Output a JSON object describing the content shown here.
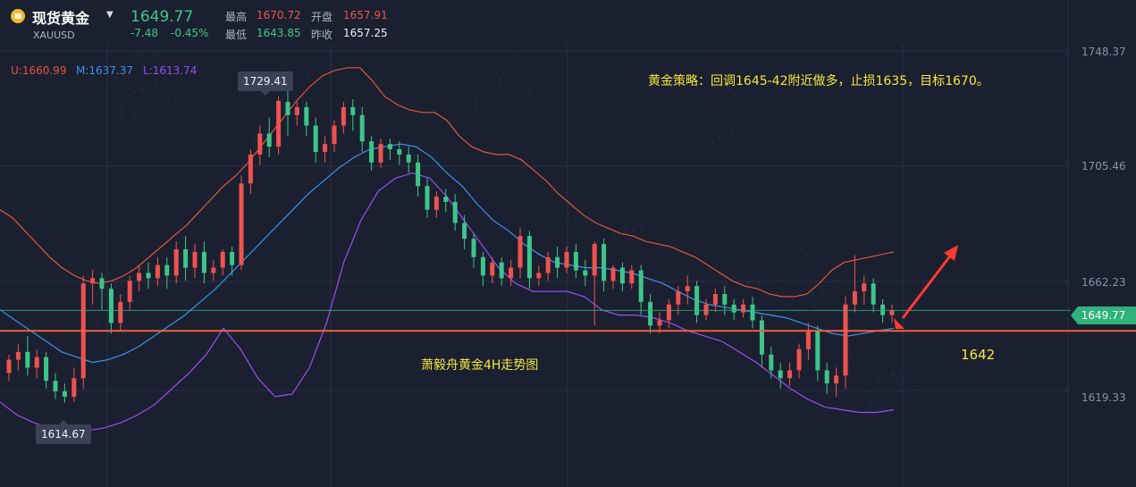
{
  "header": {
    "name": "现货黄金",
    "code": "XAUUSD",
    "price": "1649.77",
    "change": "-7.48",
    "change_pct": "-0.45%",
    "high_label": "最高",
    "high": "1670.72",
    "low_label": "最低",
    "low": "1643.85",
    "open_label": "开盘",
    "open": "1657.91",
    "prev_label": "昨收",
    "prev_close": "1657.25"
  },
  "indicator": {
    "upper": "U:1660.99",
    "middle": "M:1637.37",
    "lower": "L:1613.74"
  },
  "annotations": {
    "strategy": "黄金策略：回调1645-42附近做多，止损1635，目标1670。",
    "watermark": "萧毅舟黄金4H走势图",
    "level": "1642",
    "max_tip": "1729.41",
    "min_tip": "1614.67",
    "current_tag": "1649.77"
  },
  "colors": {
    "background": "#1b2030",
    "up": "#ef5350",
    "down": "#3ec58a",
    "boll_upper": "#e2563a",
    "boll_middle": "#3f8fe8",
    "boll_lower": "#9a4df2",
    "support_line": "#f0613c",
    "current_line": "#2fb37a",
    "annotation_text": "#f5e63c",
    "arrow": "#ff3b30"
  },
  "chart_data": {
    "type": "candlestick",
    "y_ticks": [
      1748.37,
      1705.46,
      1662.23,
      1619.33
    ],
    "ylim": [
      1595,
      1755
    ],
    "grid": true,
    "horizontal_lines": [
      {
        "name": "current",
        "value": 1649.77
      },
      {
        "name": "support",
        "value": 1642
      }
    ],
    "candles": [
      [
        1626,
        1631,
        1623,
        1633
      ],
      [
        1631,
        1634,
        1627,
        1637
      ],
      [
        1634,
        1628,
        1625,
        1640
      ],
      [
        1628,
        1632,
        1624,
        1635
      ],
      [
        1632,
        1623,
        1620,
        1634
      ],
      [
        1623,
        1619,
        1616,
        1626
      ],
      [
        1619,
        1617,
        1614.67,
        1622
      ],
      [
        1617,
        1624,
        1615,
        1628
      ],
      [
        1624,
        1660,
        1620,
        1663
      ],
      [
        1660,
        1662,
        1652,
        1665
      ],
      [
        1662,
        1658,
        1650,
        1664
      ],
      [
        1658,
        1645,
        1641,
        1660
      ],
      [
        1645,
        1653,
        1642,
        1656
      ],
      [
        1653,
        1661,
        1650,
        1663
      ],
      [
        1661,
        1664,
        1657,
        1667
      ],
      [
        1664,
        1662,
        1658,
        1668
      ],
      [
        1662,
        1667,
        1659,
        1670
      ],
      [
        1667,
        1663,
        1658,
        1670
      ],
      [
        1663,
        1673,
        1660,
        1676
      ],
      [
        1673,
        1666,
        1661,
        1678
      ],
      [
        1666,
        1672,
        1662,
        1675
      ],
      [
        1672,
        1664,
        1660,
        1676
      ],
      [
        1664,
        1666,
        1661,
        1669
      ],
      [
        1666,
        1672,
        1663,
        1673
      ],
      [
        1672,
        1667,
        1663,
        1674
      ],
      [
        1667,
        1698,
        1665,
        1701
      ],
      [
        1698,
        1709,
        1694,
        1711
      ],
      [
        1709,
        1717,
        1705,
        1720
      ],
      [
        1717,
        1712,
        1708,
        1723
      ],
      [
        1712,
        1729.41,
        1709,
        1731
      ],
      [
        1729,
        1724,
        1716,
        1733
      ],
      [
        1724,
        1727,
        1720,
        1729
      ],
      [
        1727,
        1720,
        1716,
        1729
      ],
      [
        1720,
        1710,
        1706,
        1723
      ],
      [
        1710,
        1713,
        1706,
        1716
      ],
      [
        1713,
        1720,
        1710,
        1722
      ],
      [
        1720,
        1727,
        1717,
        1729
      ],
      [
        1727,
        1724,
        1718,
        1730
      ],
      [
        1724,
        1714,
        1710,
        1727
      ],
      [
        1714,
        1706,
        1703,
        1716
      ],
      [
        1706,
        1713,
        1704,
        1715
      ],
      [
        1713,
        1711,
        1707,
        1715
      ],
      [
        1711,
        1709,
        1705,
        1714
      ],
      [
        1709,
        1706,
        1702,
        1712
      ],
      [
        1706,
        1697,
        1693,
        1709
      ],
      [
        1697,
        1688,
        1685,
        1700
      ],
      [
        1688,
        1693,
        1685,
        1695
      ],
      [
        1693,
        1691,
        1687,
        1696
      ],
      [
        1691,
        1683,
        1680,
        1694
      ],
      [
        1683,
        1677,
        1673,
        1686
      ],
      [
        1677,
        1670,
        1666,
        1679
      ],
      [
        1670,
        1663,
        1659,
        1672
      ],
      [
        1663,
        1668,
        1660,
        1670
      ],
      [
        1668,
        1662,
        1659,
        1670
      ],
      [
        1662,
        1666,
        1659,
        1669
      ],
      [
        1666,
        1678,
        1662,
        1681
      ],
      [
        1678,
        1662,
        1658,
        1680
      ],
      [
        1662,
        1664,
        1659,
        1667
      ],
      [
        1664,
        1670,
        1661,
        1672
      ],
      [
        1670,
        1666,
        1662,
        1674
      ],
      [
        1666,
        1672,
        1664,
        1674
      ],
      [
        1672,
        1665,
        1662,
        1675
      ],
      [
        1665,
        1663,
        1659,
        1669
      ],
      [
        1663,
        1675,
        1644,
        1676
      ],
      [
        1675,
        1661,
        1657,
        1677
      ],
      [
        1661,
        1666,
        1658,
        1667
      ],
      [
        1666,
        1660,
        1657,
        1668
      ],
      [
        1660,
        1665,
        1658,
        1667
      ],
      [
        1665,
        1653,
        1648,
        1667
      ],
      [
        1653,
        1644,
        1641,
        1656
      ],
      [
        1644,
        1646,
        1641,
        1649
      ],
      [
        1646,
        1652,
        1643,
        1654
      ],
      [
        1652,
        1657,
        1648,
        1659
      ],
      [
        1657,
        1659,
        1652,
        1663
      ],
      [
        1659,
        1648,
        1645,
        1661
      ],
      [
        1648,
        1652,
        1646,
        1654
      ],
      [
        1652,
        1656,
        1649,
        1658
      ],
      [
        1656,
        1652,
        1648,
        1659
      ],
      [
        1652,
        1649,
        1646,
        1654
      ],
      [
        1649,
        1652,
        1647,
        1654
      ],
      [
        1652,
        1646,
        1643,
        1655
      ],
      [
        1646,
        1633,
        1628,
        1648
      ],
      [
        1633,
        1627,
        1624,
        1636
      ],
      [
        1627,
        1624,
        1620,
        1630
      ],
      [
        1624,
        1627,
        1621,
        1630
      ],
      [
        1627,
        1635,
        1624,
        1637
      ],
      [
        1635,
        1642,
        1631,
        1645
      ],
      [
        1642,
        1627,
        1623,
        1644
      ],
      [
        1627,
        1622,
        1618,
        1630
      ],
      [
        1622,
        1625,
        1617,
        1628
      ],
      [
        1625,
        1652,
        1620,
        1655
      ],
      [
        1652,
        1657,
        1649,
        1670.72
      ],
      [
        1657,
        1660,
        1652,
        1663
      ],
      [
        1660,
        1652,
        1649,
        1662
      ],
      [
        1652,
        1648,
        1645,
        1654
      ],
      [
        1648,
        1649.77,
        1645,
        1652
      ]
    ],
    "bollinger": {
      "upper": [
        1688,
        1685,
        1680,
        1675,
        1670,
        1666,
        1663,
        1661,
        1660,
        1661,
        1663,
        1666,
        1670,
        1674,
        1678,
        1682,
        1687,
        1692,
        1697,
        1701,
        1706,
        1712,
        1718,
        1724,
        1730,
        1735,
        1739,
        1741,
        1742,
        1742,
        1737,
        1731,
        1728,
        1726,
        1725,
        1725,
        1722,
        1716,
        1712,
        1710,
        1709,
        1709,
        1707,
        1703,
        1699,
        1694,
        1690,
        1686,
        1683,
        1681,
        1679,
        1678,
        1676,
        1675,
        1674,
        1672,
        1670,
        1667,
        1664,
        1661,
        1659,
        1658,
        1656,
        1655,
        1655,
        1656,
        1660,
        1665,
        1668,
        1669,
        1670,
        1671,
        1672
      ],
      "middle": [
        1650,
        1646,
        1642,
        1638,
        1634,
        1632,
        1630,
        1631,
        1633,
        1636,
        1640,
        1644,
        1648,
        1653,
        1658,
        1664,
        1670,
        1676,
        1682,
        1688,
        1694,
        1699,
        1704,
        1708,
        1711,
        1712,
        1713,
        1712,
        1708,
        1702,
        1697,
        1690,
        1684,
        1680,
        1675,
        1671,
        1668,
        1667,
        1666,
        1666,
        1665,
        1664,
        1662,
        1660,
        1657,
        1654,
        1652,
        1651,
        1650,
        1649,
        1648,
        1647,
        1645,
        1643,
        1641,
        1640,
        1641,
        1642,
        1643
      ],
      "lower": [
        1615,
        1610,
        1607,
        1605,
        1604,
        1604,
        1605,
        1607,
        1610,
        1614,
        1620,
        1626,
        1633,
        1643,
        1635,
        1624,
        1617,
        1618,
        1628,
        1645,
        1668,
        1684,
        1695,
        1700,
        1702,
        1700,
        1693,
        1684,
        1675,
        1666,
        1660,
        1657,
        1657,
        1657,
        1655,
        1650,
        1648,
        1648,
        1647,
        1645,
        1642,
        1640,
        1638,
        1634,
        1630,
        1625,
        1620,
        1616,
        1613,
        1612,
        1611,
        1611,
        1612
      ]
    }
  }
}
